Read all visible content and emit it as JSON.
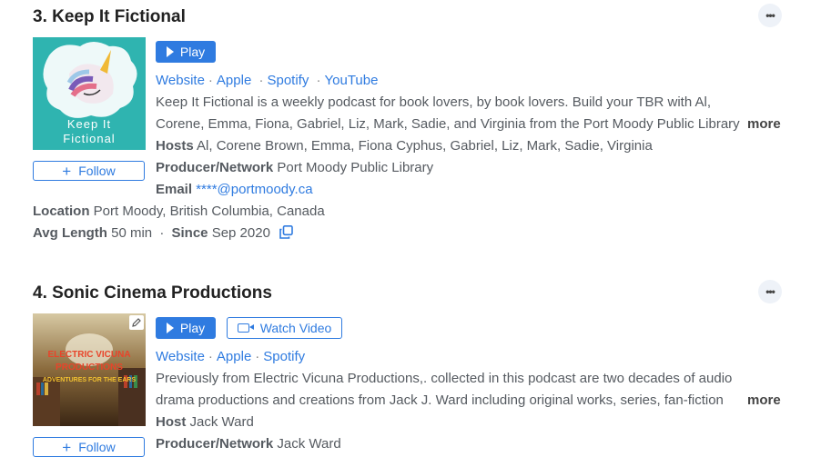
{
  "podcasts": [
    {
      "title": "3. Keep It Fictional",
      "cover_text": [
        "Keep It",
        "Fictional"
      ],
      "follow_label": "Follow",
      "play_label": "Play",
      "links": [
        "Website",
        "Apple",
        "Spotify",
        "YouTube"
      ],
      "description": "Keep It Fictional is a weekly podcast for book lovers, by book lovers. Build your TBR with Al, Corene, Emma, Fiona, Gabriel, Liz, Mark, Sadie, and Virginia from the Port Moody Public Library",
      "more_label": "more",
      "hosts_label": "Hosts",
      "hosts": "Al, Corene Brown, Emma, Fiona Cyphus, Gabriel, Liz, Mark, Sadie, Virginia",
      "producer_label": "Producer/Network",
      "producer": "Port Moody Public Library",
      "email_label": "Email",
      "email": "****@portmoody.ca",
      "location_label": "Location",
      "location": "Port Moody, British Columbia, Canada",
      "avg_length_label": "Avg Length",
      "avg_length": "50 min",
      "since_label": "Since",
      "since": "Sep 2020"
    },
    {
      "title": "4. Sonic Cinema Productions",
      "cover_text": [
        "ELECTRIC VICUNA",
        "PRODUCTIONS",
        "ADVENTURES FOR THE EARS"
      ],
      "follow_label": "Follow",
      "play_label": "Play",
      "video_label": "Watch Video",
      "links": [
        "Website",
        "Apple",
        "Spotify"
      ],
      "description": "Previously from Electric Vicuna Productions,. collected in this podcast are two decades of audio drama productions and creations from Jack J. Ward including original works, series, fan-fiction and more",
      "more_label": "more",
      "host_label": "Host",
      "host": "Jack Ward",
      "producer_label": "Producer/Network",
      "producer": "Jack Ward"
    }
  ],
  "colors": {
    "accent": "#2f7be0",
    "text": "#555a60",
    "title": "#222222",
    "cover1_bg": "#2fb4b0"
  },
  "icons": [
    "more-dots-icon",
    "play-icon",
    "plus-icon",
    "video-camera-icon",
    "copy-icon",
    "pencil-icon"
  ]
}
